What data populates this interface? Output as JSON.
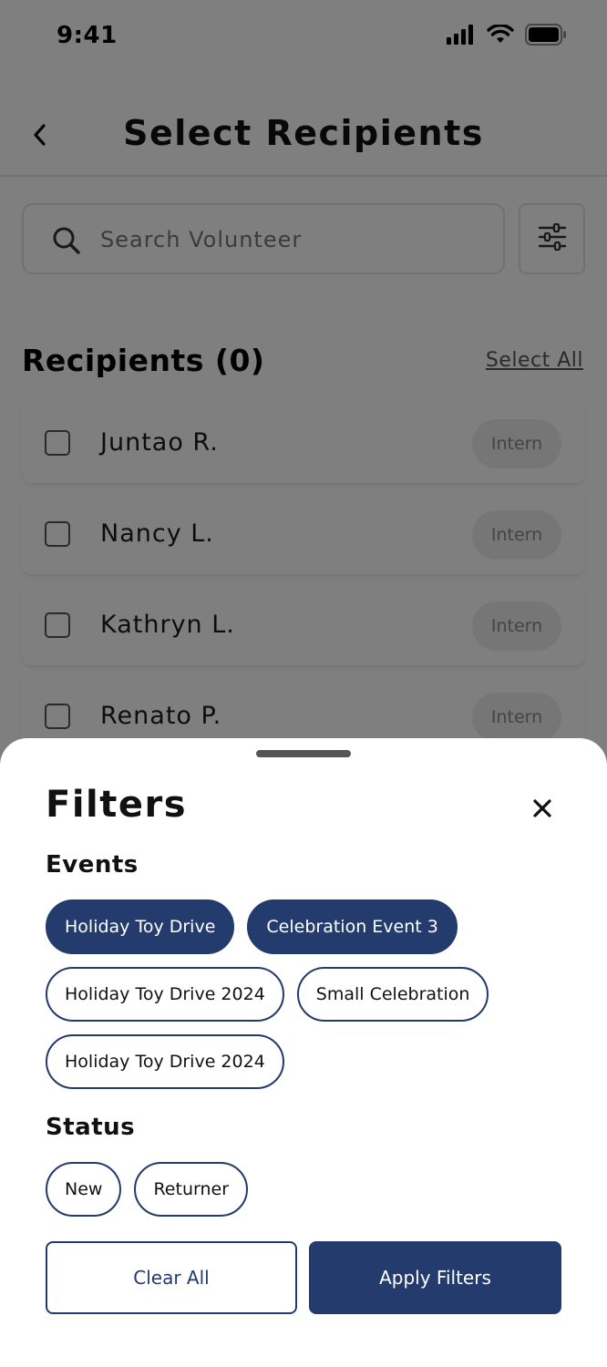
{
  "status_bar": {
    "time": "9:41"
  },
  "header": {
    "title": "Select Recipients",
    "back_icon": "chevron-left-icon"
  },
  "search": {
    "placeholder": "Search Volunteer",
    "value": "",
    "icon": "search-icon"
  },
  "filter_button": {
    "icon": "sliders-icon"
  },
  "recipients": {
    "heading": "Recipients (0)",
    "select_all_label": "Select All",
    "items": [
      {
        "name": "Juntao R.",
        "role": "Intern",
        "checked": false
      },
      {
        "name": "Nancy L.",
        "role": "Intern",
        "checked": false
      },
      {
        "name": "Kathryn L.",
        "role": "Intern",
        "checked": false
      },
      {
        "name": "Renato P.",
        "role": "Intern",
        "checked": false
      }
    ]
  },
  "filters_sheet": {
    "title": "Filters",
    "events_title": "Events",
    "events": [
      {
        "label": "Holiday Toy Drive",
        "selected": true
      },
      {
        "label": "Celebration Event 3",
        "selected": true
      },
      {
        "label": "Holiday Toy Drive 2024",
        "selected": false
      },
      {
        "label": "Small Celebration",
        "selected": false
      },
      {
        "label": "Holiday Toy Drive 2024",
        "selected": false
      }
    ],
    "status_title": "Status",
    "statuses": [
      {
        "label": "New",
        "selected": false
      },
      {
        "label": "Returner",
        "selected": false
      }
    ],
    "clear_label": "Clear All",
    "apply_label": "Apply Filters"
  },
  "colors": {
    "primary": "#243b6e",
    "chip_border": "#233a6c",
    "badge_bg": "#ececec",
    "overlay": "rgba(0,0,0,0.5)"
  }
}
